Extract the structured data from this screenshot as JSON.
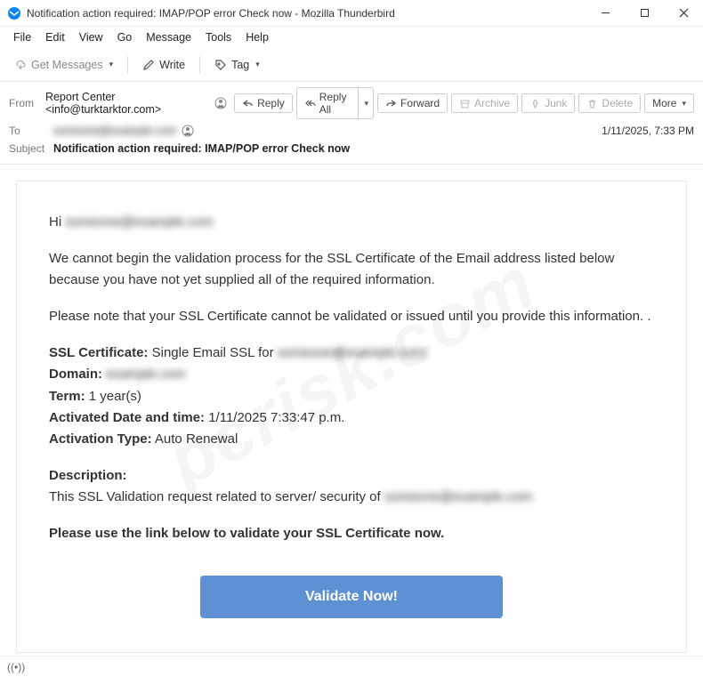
{
  "window": {
    "title": "Notification action required: IMAP/POP error Check now - Mozilla Thunderbird"
  },
  "menu": {
    "file": "File",
    "edit": "Edit",
    "view": "View",
    "go": "Go",
    "message": "Message",
    "tools": "Tools",
    "help": "Help"
  },
  "toolbar": {
    "get_messages": "Get Messages",
    "write": "Write",
    "tag": "Tag"
  },
  "actions": {
    "reply": "Reply",
    "reply_all": "Reply All",
    "forward": "Forward",
    "archive": "Archive",
    "junk": "Junk",
    "delete": "Delete",
    "more": "More"
  },
  "header": {
    "from_label": "From",
    "from_value": "Report Center <info@turktarktor.com>",
    "to_label": "To",
    "to_value_redacted": "someone@example.com",
    "subject_label": "Subject",
    "subject_value": "Notification action required: IMAP/POP error Check now",
    "datetime": "1/11/2025, 7:33 PM"
  },
  "body": {
    "greeting_prefix": "Hi ",
    "greeting_redacted": "someone@example.com",
    "p1": "We cannot begin the validation process for the SSL Certificate of the Email address listed below because you have not yet supplied all of the required information.",
    "p2": "Please note that your SSL Certificate cannot be validated or issued until you provide this information. .",
    "f_ssl_label": "SSL Certificate:",
    "f_ssl_value": " Single Email SSL for ",
    "f_ssl_redacted": "someone@example.com",
    "f_domain_label": "Domain:",
    "f_domain_redacted": "example.com",
    "f_term_label": "Term:",
    "f_term_value": " 1 year(s)",
    "f_act_label": "Activated Date and time:",
    "f_act_value": " 1/11/2025 7:33:47 p.m.",
    "f_type_label": "Activation Type:",
    "f_type_value": " Auto Renewal",
    "desc_label": "Description:",
    "desc_text_prefix": "This SSL Validation request related to server/ security of ",
    "desc_redacted": "someone@example.com",
    "cta_text": "Please use the link below to validate your SSL Certificate now.",
    "button": "Validate Now!"
  },
  "watermark": "pcrisk.com"
}
